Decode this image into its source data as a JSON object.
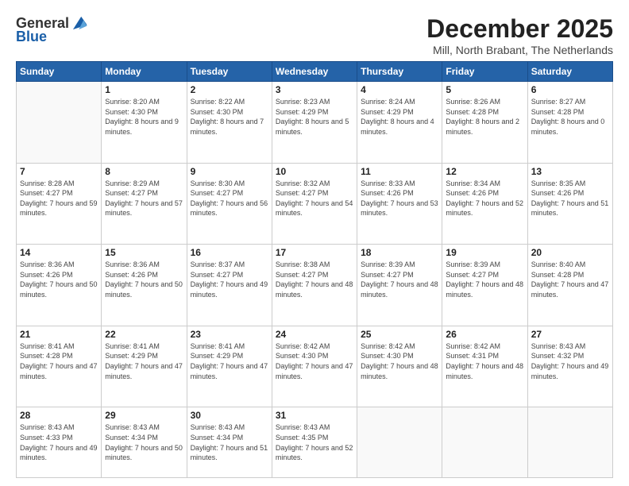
{
  "header": {
    "logo_line1": "General",
    "logo_line2": "Blue",
    "month": "December 2025",
    "location": "Mill, North Brabant, The Netherlands"
  },
  "weekdays": [
    "Sunday",
    "Monday",
    "Tuesday",
    "Wednesday",
    "Thursday",
    "Friday",
    "Saturday"
  ],
  "weeks": [
    [
      {
        "day": "",
        "sunrise": "",
        "sunset": "",
        "daylight": ""
      },
      {
        "day": "1",
        "sunrise": "Sunrise: 8:20 AM",
        "sunset": "Sunset: 4:30 PM",
        "daylight": "Daylight: 8 hours and 9 minutes."
      },
      {
        "day": "2",
        "sunrise": "Sunrise: 8:22 AM",
        "sunset": "Sunset: 4:30 PM",
        "daylight": "Daylight: 8 hours and 7 minutes."
      },
      {
        "day": "3",
        "sunrise": "Sunrise: 8:23 AM",
        "sunset": "Sunset: 4:29 PM",
        "daylight": "Daylight: 8 hours and 5 minutes."
      },
      {
        "day": "4",
        "sunrise": "Sunrise: 8:24 AM",
        "sunset": "Sunset: 4:29 PM",
        "daylight": "Daylight: 8 hours and 4 minutes."
      },
      {
        "day": "5",
        "sunrise": "Sunrise: 8:26 AM",
        "sunset": "Sunset: 4:28 PM",
        "daylight": "Daylight: 8 hours and 2 minutes."
      },
      {
        "day": "6",
        "sunrise": "Sunrise: 8:27 AM",
        "sunset": "Sunset: 4:28 PM",
        "daylight": "Daylight: 8 hours and 0 minutes."
      }
    ],
    [
      {
        "day": "7",
        "sunrise": "Sunrise: 8:28 AM",
        "sunset": "Sunset: 4:27 PM",
        "daylight": "Daylight: 7 hours and 59 minutes."
      },
      {
        "day": "8",
        "sunrise": "Sunrise: 8:29 AM",
        "sunset": "Sunset: 4:27 PM",
        "daylight": "Daylight: 7 hours and 57 minutes."
      },
      {
        "day": "9",
        "sunrise": "Sunrise: 8:30 AM",
        "sunset": "Sunset: 4:27 PM",
        "daylight": "Daylight: 7 hours and 56 minutes."
      },
      {
        "day": "10",
        "sunrise": "Sunrise: 8:32 AM",
        "sunset": "Sunset: 4:27 PM",
        "daylight": "Daylight: 7 hours and 54 minutes."
      },
      {
        "day": "11",
        "sunrise": "Sunrise: 8:33 AM",
        "sunset": "Sunset: 4:26 PM",
        "daylight": "Daylight: 7 hours and 53 minutes."
      },
      {
        "day": "12",
        "sunrise": "Sunrise: 8:34 AM",
        "sunset": "Sunset: 4:26 PM",
        "daylight": "Daylight: 7 hours and 52 minutes."
      },
      {
        "day": "13",
        "sunrise": "Sunrise: 8:35 AM",
        "sunset": "Sunset: 4:26 PM",
        "daylight": "Daylight: 7 hours and 51 minutes."
      }
    ],
    [
      {
        "day": "14",
        "sunrise": "Sunrise: 8:36 AM",
        "sunset": "Sunset: 4:26 PM",
        "daylight": "Daylight: 7 hours and 50 minutes."
      },
      {
        "day": "15",
        "sunrise": "Sunrise: 8:36 AM",
        "sunset": "Sunset: 4:26 PM",
        "daylight": "Daylight: 7 hours and 50 minutes."
      },
      {
        "day": "16",
        "sunrise": "Sunrise: 8:37 AM",
        "sunset": "Sunset: 4:27 PM",
        "daylight": "Daylight: 7 hours and 49 minutes."
      },
      {
        "day": "17",
        "sunrise": "Sunrise: 8:38 AM",
        "sunset": "Sunset: 4:27 PM",
        "daylight": "Daylight: 7 hours and 48 minutes."
      },
      {
        "day": "18",
        "sunrise": "Sunrise: 8:39 AM",
        "sunset": "Sunset: 4:27 PM",
        "daylight": "Daylight: 7 hours and 48 minutes."
      },
      {
        "day": "19",
        "sunrise": "Sunrise: 8:39 AM",
        "sunset": "Sunset: 4:27 PM",
        "daylight": "Daylight: 7 hours and 48 minutes."
      },
      {
        "day": "20",
        "sunrise": "Sunrise: 8:40 AM",
        "sunset": "Sunset: 4:28 PM",
        "daylight": "Daylight: 7 hours and 47 minutes."
      }
    ],
    [
      {
        "day": "21",
        "sunrise": "Sunrise: 8:41 AM",
        "sunset": "Sunset: 4:28 PM",
        "daylight": "Daylight: 7 hours and 47 minutes."
      },
      {
        "day": "22",
        "sunrise": "Sunrise: 8:41 AM",
        "sunset": "Sunset: 4:29 PM",
        "daylight": "Daylight: 7 hours and 47 minutes."
      },
      {
        "day": "23",
        "sunrise": "Sunrise: 8:41 AM",
        "sunset": "Sunset: 4:29 PM",
        "daylight": "Daylight: 7 hours and 47 minutes."
      },
      {
        "day": "24",
        "sunrise": "Sunrise: 8:42 AM",
        "sunset": "Sunset: 4:30 PM",
        "daylight": "Daylight: 7 hours and 47 minutes."
      },
      {
        "day": "25",
        "sunrise": "Sunrise: 8:42 AM",
        "sunset": "Sunset: 4:30 PM",
        "daylight": "Daylight: 7 hours and 48 minutes."
      },
      {
        "day": "26",
        "sunrise": "Sunrise: 8:42 AM",
        "sunset": "Sunset: 4:31 PM",
        "daylight": "Daylight: 7 hours and 48 minutes."
      },
      {
        "day": "27",
        "sunrise": "Sunrise: 8:43 AM",
        "sunset": "Sunset: 4:32 PM",
        "daylight": "Daylight: 7 hours and 49 minutes."
      }
    ],
    [
      {
        "day": "28",
        "sunrise": "Sunrise: 8:43 AM",
        "sunset": "Sunset: 4:33 PM",
        "daylight": "Daylight: 7 hours and 49 minutes."
      },
      {
        "day": "29",
        "sunrise": "Sunrise: 8:43 AM",
        "sunset": "Sunset: 4:34 PM",
        "daylight": "Daylight: 7 hours and 50 minutes."
      },
      {
        "day": "30",
        "sunrise": "Sunrise: 8:43 AM",
        "sunset": "Sunset: 4:34 PM",
        "daylight": "Daylight: 7 hours and 51 minutes."
      },
      {
        "day": "31",
        "sunrise": "Sunrise: 8:43 AM",
        "sunset": "Sunset: 4:35 PM",
        "daylight": "Daylight: 7 hours and 52 minutes."
      },
      {
        "day": "",
        "sunrise": "",
        "sunset": "",
        "daylight": ""
      },
      {
        "day": "",
        "sunrise": "",
        "sunset": "",
        "daylight": ""
      },
      {
        "day": "",
        "sunrise": "",
        "sunset": "",
        "daylight": ""
      }
    ]
  ]
}
